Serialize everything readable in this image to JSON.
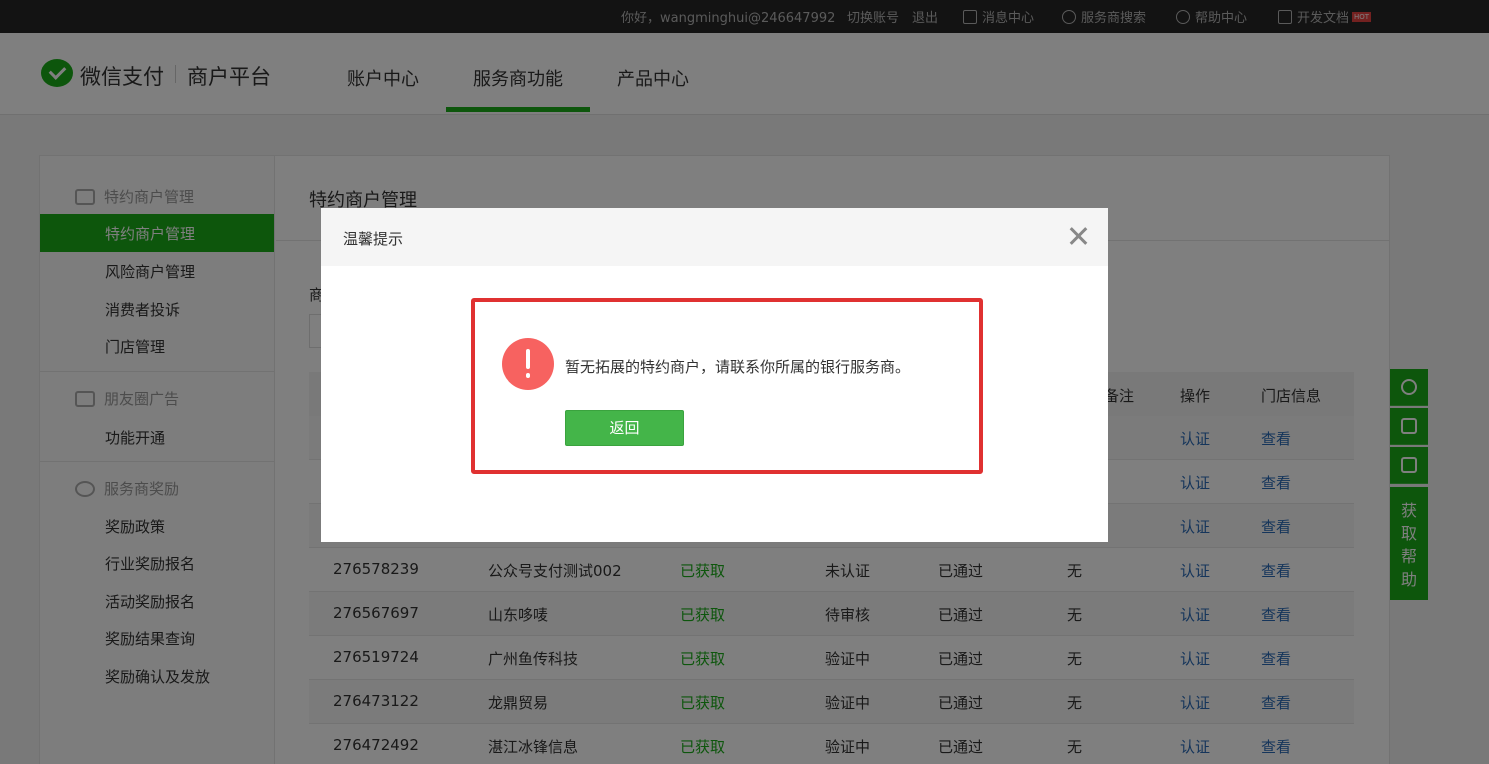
{
  "topbar": {
    "greeting": "你好，wangminghui@246647992",
    "switch_account": "切换账号",
    "logout": "退出",
    "messages": "消息中心",
    "search": "服务商搜索",
    "help": "帮助中心",
    "docs": "开发文档",
    "hot_badge": "HOT"
  },
  "header": {
    "brand": "微信支付",
    "platform": "商户平台",
    "nav": [
      "账户中心",
      "服务商功能",
      "产品中心"
    ]
  },
  "sidebar": {
    "group1": "特约商户管理",
    "group1_items": [
      "特约商户管理",
      "风险商户管理",
      "消费者投诉",
      "门店管理"
    ],
    "group2": "朋友圈广告",
    "group2_items": [
      "功能开通"
    ],
    "group3": "服务商奖励",
    "group3_items": [
      "奖励政策",
      "行业奖励报名",
      "活动奖励报名",
      "奖励结果查询",
      "奖励确认及发放"
    ]
  },
  "content": {
    "title": "特约商户管理",
    "filter_label": "商",
    "table_headers": [
      "备注",
      "操作",
      "门店信息"
    ],
    "rows": [
      {
        "id": "",
        "name": "",
        "status1": "",
        "status2": "",
        "status3": "",
        "remark": "",
        "action": "认证",
        "store": "查看"
      },
      {
        "id": "",
        "name": "",
        "status1": "",
        "status2": "",
        "status3": "",
        "remark": "",
        "action": "认证",
        "store": "查看"
      },
      {
        "id": "",
        "name": "",
        "status1": "",
        "status2": "",
        "status3": "",
        "remark": "",
        "action": "认证",
        "store": "查看"
      },
      {
        "id": "276578239",
        "name": "公众号支付测试002",
        "status1": "已获取",
        "status2": "未认证",
        "status3": "已通过",
        "remark": "无",
        "action": "认证",
        "store": "查看"
      },
      {
        "id": "276567697",
        "name": "山东哆唛",
        "status1": "已获取",
        "status2": "待审核",
        "status3": "已通过",
        "remark": "无",
        "action": "认证",
        "store": "查看"
      },
      {
        "id": "276519724",
        "name": "广州鱼传科技",
        "status1": "已获取",
        "status2": "验证中",
        "status3": "已通过",
        "remark": "无",
        "action": "认证",
        "store": "查看"
      },
      {
        "id": "276473122",
        "name": "龙鼎贸易",
        "status1": "已获取",
        "status2": "验证中",
        "status3": "已通过",
        "remark": "无",
        "action": "认证",
        "store": "查看"
      },
      {
        "id": "276472492",
        "name": "湛江冰锋信息",
        "status1": "已获取",
        "status2": "验证中",
        "status3": "已通过",
        "remark": "无",
        "action": "认证",
        "store": "查看"
      }
    ]
  },
  "float_help": {
    "label": "获取帮助",
    "chars": [
      "获",
      "取",
      "帮",
      "助"
    ]
  },
  "dialog": {
    "title": "温馨提示",
    "message": "暂无拓展的特约商户，请联系你所属的银行服务商。",
    "button": "返回"
  },
  "colors": {
    "brand_green": "#1aad19",
    "warning_red": "#f76260",
    "highlight_red": "#e03131",
    "link_blue": "#2a6ab6"
  }
}
